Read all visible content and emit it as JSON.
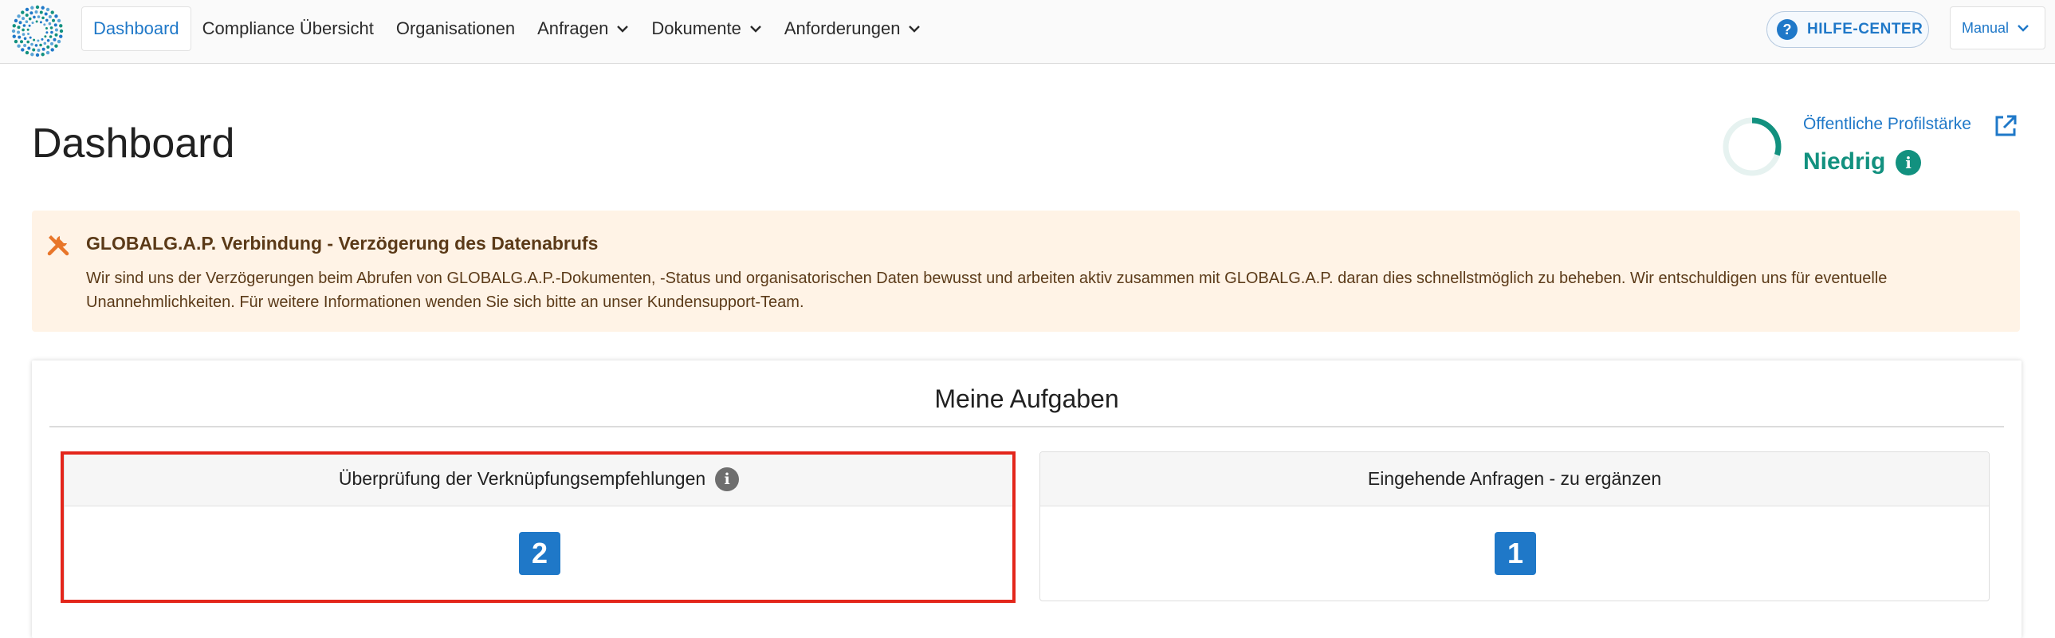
{
  "navbar": {
    "logo_icon": "dotted-circle-logo-icon",
    "items": [
      {
        "label": "Dashboard",
        "active": true
      },
      {
        "label": "Compliance Übersicht"
      },
      {
        "label": "Organisationen"
      },
      {
        "label": "Anfragen",
        "dropdown": true
      },
      {
        "label": "Dokumente",
        "dropdown": true
      },
      {
        "label": "Anforderungen",
        "dropdown": true
      }
    ],
    "help_label": "HILFE-CENTER",
    "help_icon": "question-circle-icon",
    "manual_label": "Manual"
  },
  "header": {
    "title": "Dashboard",
    "profile_link": "Öffentliche Profilstärke",
    "profile_level": "Niedrig",
    "profile_progress": 0.3
  },
  "alert": {
    "icon": "tools-icon",
    "title": "GLOBALG.A.P. Verbindung - Verzögerung des Datenabrufs",
    "text": "Wir sind uns der Verzögerungen beim Abrufen von GLOBALG.A.P.-Dokumenten, -Status und organisatorischen Daten bewusst und arbeiten aktiv zusammen mit GLOBALG.A.P. daran dies schnellstmöglich zu beheben. Wir entschuldigen uns für eventuelle Unannehmlichkeiten. Für weitere Informationen wenden Sie sich bitte an unser Kundensupport-Team."
  },
  "tasks": {
    "title": "Meine Aufgaben",
    "panels": [
      {
        "title": "Überprüfung der Verknüpfungsempfehlungen",
        "count": "2",
        "has_info": true
      },
      {
        "title": "Eingehende Anfragen - zu ergänzen",
        "count": "1"
      }
    ]
  },
  "colors": {
    "primary": "#1f78c8",
    "success": "#12917f",
    "alert_bg": "#fff3e6",
    "alert_text": "#5b3a18",
    "highlight": "#e3261b"
  }
}
